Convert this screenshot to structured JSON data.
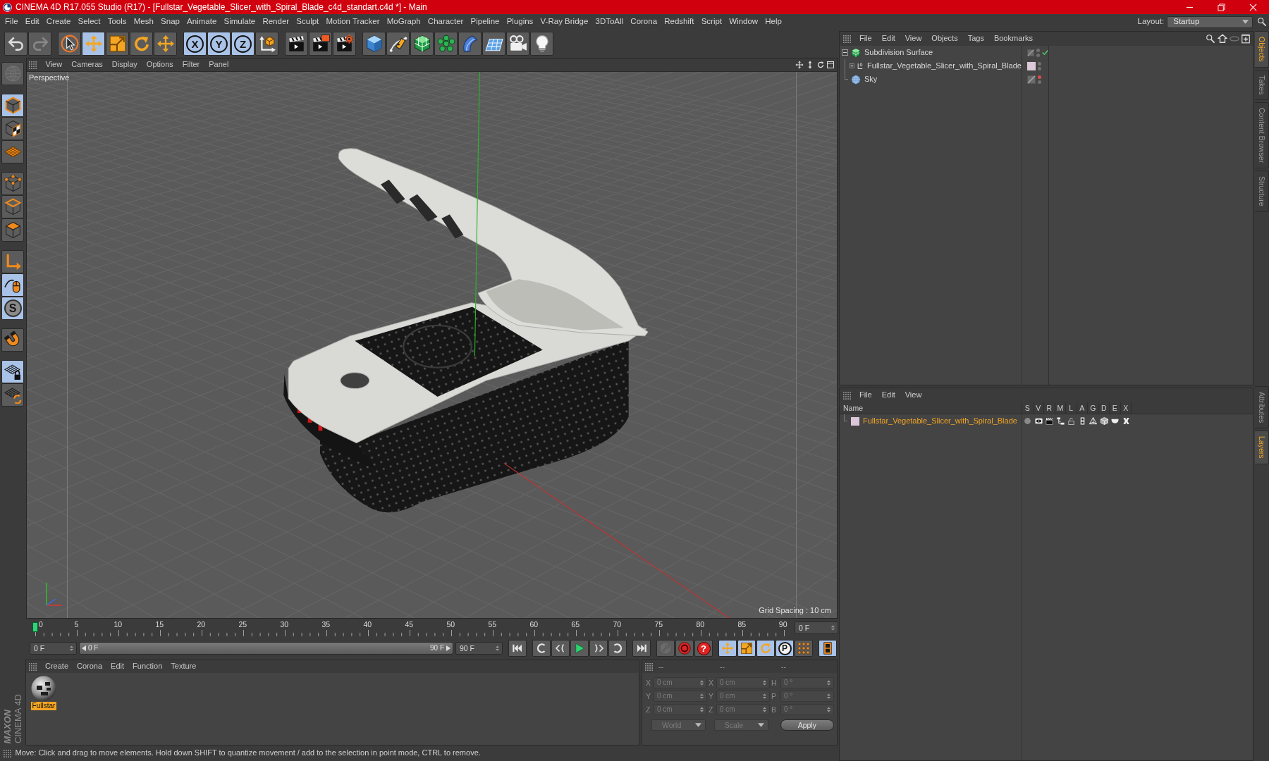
{
  "window": {
    "title": "CINEMA 4D R17.055 Studio (R17) - [Fullstar_Vegetable_Slicer_with_Spiral_Blade_c4d_standart.c4d *] - Main"
  },
  "menu_bar": [
    "File",
    "Edit",
    "Create",
    "Select",
    "Tools",
    "Mesh",
    "Snap",
    "Animate",
    "Simulate",
    "Render",
    "Sculpt",
    "Motion Tracker",
    "MoGraph",
    "Character",
    "Pipeline",
    "Plugins",
    "V-Ray Bridge",
    "3DToAll",
    "Corona",
    "Redshift",
    "Script",
    "Window",
    "Help"
  ],
  "layout": {
    "label": "Layout:",
    "value": "Startup"
  },
  "toolbar": [
    [
      {
        "kind": "undo",
        "disabled": false
      },
      {
        "kind": "redo",
        "disabled": true
      }
    ],
    [
      {
        "kind": "live-select",
        "selected": false
      },
      {
        "kind": "move",
        "selected": true
      },
      {
        "kind": "scale",
        "selected": false
      },
      {
        "kind": "rotate",
        "selected": false
      },
      {
        "kind": "recent-tool",
        "selected": false
      }
    ],
    [
      {
        "kind": "axis-lock",
        "label": "X",
        "selected": true
      },
      {
        "kind": "axis-lock",
        "label": "Y",
        "selected": true
      },
      {
        "kind": "axis-lock",
        "label": "Z",
        "selected": true
      },
      {
        "kind": "coord-system",
        "selected": false
      }
    ],
    [
      {
        "kind": "render-view"
      },
      {
        "kind": "render-picture-viewer"
      },
      {
        "kind": "render-settings"
      }
    ],
    [
      {
        "kind": "cube"
      },
      {
        "kind": "pen"
      },
      {
        "kind": "subdivision"
      },
      {
        "kind": "cloner"
      },
      {
        "kind": "bend"
      },
      {
        "kind": "floor"
      },
      {
        "kind": "camera"
      },
      {
        "kind": "light"
      }
    ]
  ],
  "mode_toolbar": [
    [
      {
        "kind": "make-editable",
        "disabled": true
      }
    ],
    [
      {
        "kind": "model-mode",
        "selected": true
      },
      {
        "kind": "texture-mode",
        "selected": false
      },
      {
        "kind": "workplane-mode",
        "selected": false
      }
    ],
    [
      {
        "kind": "points-mode",
        "selected": false
      },
      {
        "kind": "edges-mode",
        "selected": false
      },
      {
        "kind": "polygons-mode",
        "selected": false
      }
    ],
    [
      {
        "kind": "axis-mode",
        "selected": false
      },
      {
        "kind": "tweak-mode",
        "selected": true
      },
      {
        "kind": "snap",
        "label": "S",
        "selected": true
      }
    ],
    [
      {
        "kind": "magnet",
        "selected": false
      }
    ],
    [
      {
        "kind": "lock-workplane",
        "selected": true
      },
      {
        "kind": "planar-workplane",
        "selected": false
      }
    ]
  ],
  "viewport": {
    "menu": [
      "View",
      "Cameras",
      "Display",
      "Options",
      "Filter",
      "Panel"
    ],
    "camera": "Perspective",
    "grid_spacing": "Grid Spacing : 10 cm"
  },
  "timeline": {
    "ticks": [
      "0",
      "5",
      "10",
      "15",
      "20",
      "25",
      "30",
      "35",
      "40",
      "45",
      "50",
      "55",
      "60",
      "65",
      "70",
      "75",
      "80",
      "85",
      "90"
    ],
    "level": 0,
    "current_frame": "0 F"
  },
  "playback": {
    "start_frame": "0 F",
    "preview_range": {
      "start": "0 F",
      "end": "90 F"
    },
    "end_frame": "90 F",
    "button_groups": [
      [
        {
          "kind": "go-start"
        }
      ],
      [
        {
          "kind": "prev-key"
        },
        {
          "kind": "prev-frame"
        },
        {
          "kind": "play"
        },
        {
          "kind": "next-frame"
        },
        {
          "kind": "next-key"
        }
      ],
      [
        {
          "kind": "go-end"
        }
      ],
      [
        {
          "kind": "record-active",
          "disabled": true
        },
        {
          "kind": "autokey",
          "disabled": false
        },
        {
          "kind": "key-selection",
          "label": "?",
          "disabled": false
        }
      ],
      [
        {
          "kind": "key-move",
          "selected": true
        },
        {
          "kind": "key-scale",
          "selected": true
        },
        {
          "kind": "key-rotate",
          "selected": true
        },
        {
          "kind": "key-param",
          "label": "P",
          "selected": true
        },
        {
          "kind": "key-points",
          "selected": false
        }
      ],
      [
        {
          "kind": "timeline",
          "selected": true
        }
      ]
    ]
  },
  "material_manager": {
    "menu": [
      "Create",
      "Corona",
      "Edit",
      "Function",
      "Texture"
    ],
    "materials": [
      {
        "name": "Fullstar",
        "selected": true
      }
    ]
  },
  "coordinates": {
    "headers": [
      "--",
      "--",
      "--"
    ],
    "rows": [
      {
        "position_axis": "X",
        "position": "0 cm",
        "size_axis": "X",
        "size": "0 cm",
        "rotation_axis": "H",
        "rotation": "0 °"
      },
      {
        "position_axis": "Y",
        "position": "0 cm",
        "size_axis": "Y",
        "size": "0 cm",
        "rotation_axis": "P",
        "rotation": "0 °"
      },
      {
        "position_axis": "Z",
        "position": "0 cm",
        "size_axis": "Z",
        "size": "0 cm",
        "rotation_axis": "B",
        "rotation": "0 °"
      }
    ],
    "coordinate_mode": "World",
    "size_mode": "Scale",
    "apply": "Apply"
  },
  "status_bar": "Move: Click and drag to move elements. Hold down SHIFT to quantize movement / add to the selection in point mode, CTRL to remove.",
  "logo": {
    "brand": "MAXON",
    "product": "CINEMA 4D"
  },
  "object_manager": {
    "menu": [
      "File",
      "Edit",
      "View",
      "Objects",
      "Tags",
      "Bookmarks"
    ],
    "objects": [
      {
        "name": "Subdivision Surface",
        "kind": "subdivision",
        "expanded": true,
        "editor_hidden": false,
        "render_hidden": false,
        "enabled": true,
        "children": [
          {
            "name": "Fullstar_Vegetable_Slicer_with_Spiral_Blade",
            "kind": "null",
            "expanded": false,
            "color": "#dcc8d8",
            "editor_hidden": false,
            "render_hidden": false
          }
        ]
      },
      {
        "name": "Sky",
        "kind": "sky",
        "editor_hidden": true,
        "render_hidden": false
      }
    ]
  },
  "layer_manager": {
    "menu": [
      "File",
      "Edit",
      "View"
    ],
    "columns": [
      "Name",
      "S",
      "V",
      "R",
      "M",
      "L",
      "A",
      "G",
      "D",
      "E",
      "X"
    ],
    "layers": [
      {
        "name": "Fullstar_Vegetable_Slicer_with_Spiral_Blade",
        "color": "#dcc8d8",
        "selected": true
      }
    ]
  },
  "side_tabs": {
    "top": [
      {
        "label": "Objects",
        "selected": true
      },
      {
        "label": "Takes",
        "selected": false
      },
      {
        "label": "Content Browser",
        "selected": false
      },
      {
        "label": "Structure",
        "selected": false
      }
    ],
    "bottom": [
      {
        "label": "Attributes",
        "selected": false
      },
      {
        "label": "Layers",
        "selected": true
      }
    ]
  }
}
